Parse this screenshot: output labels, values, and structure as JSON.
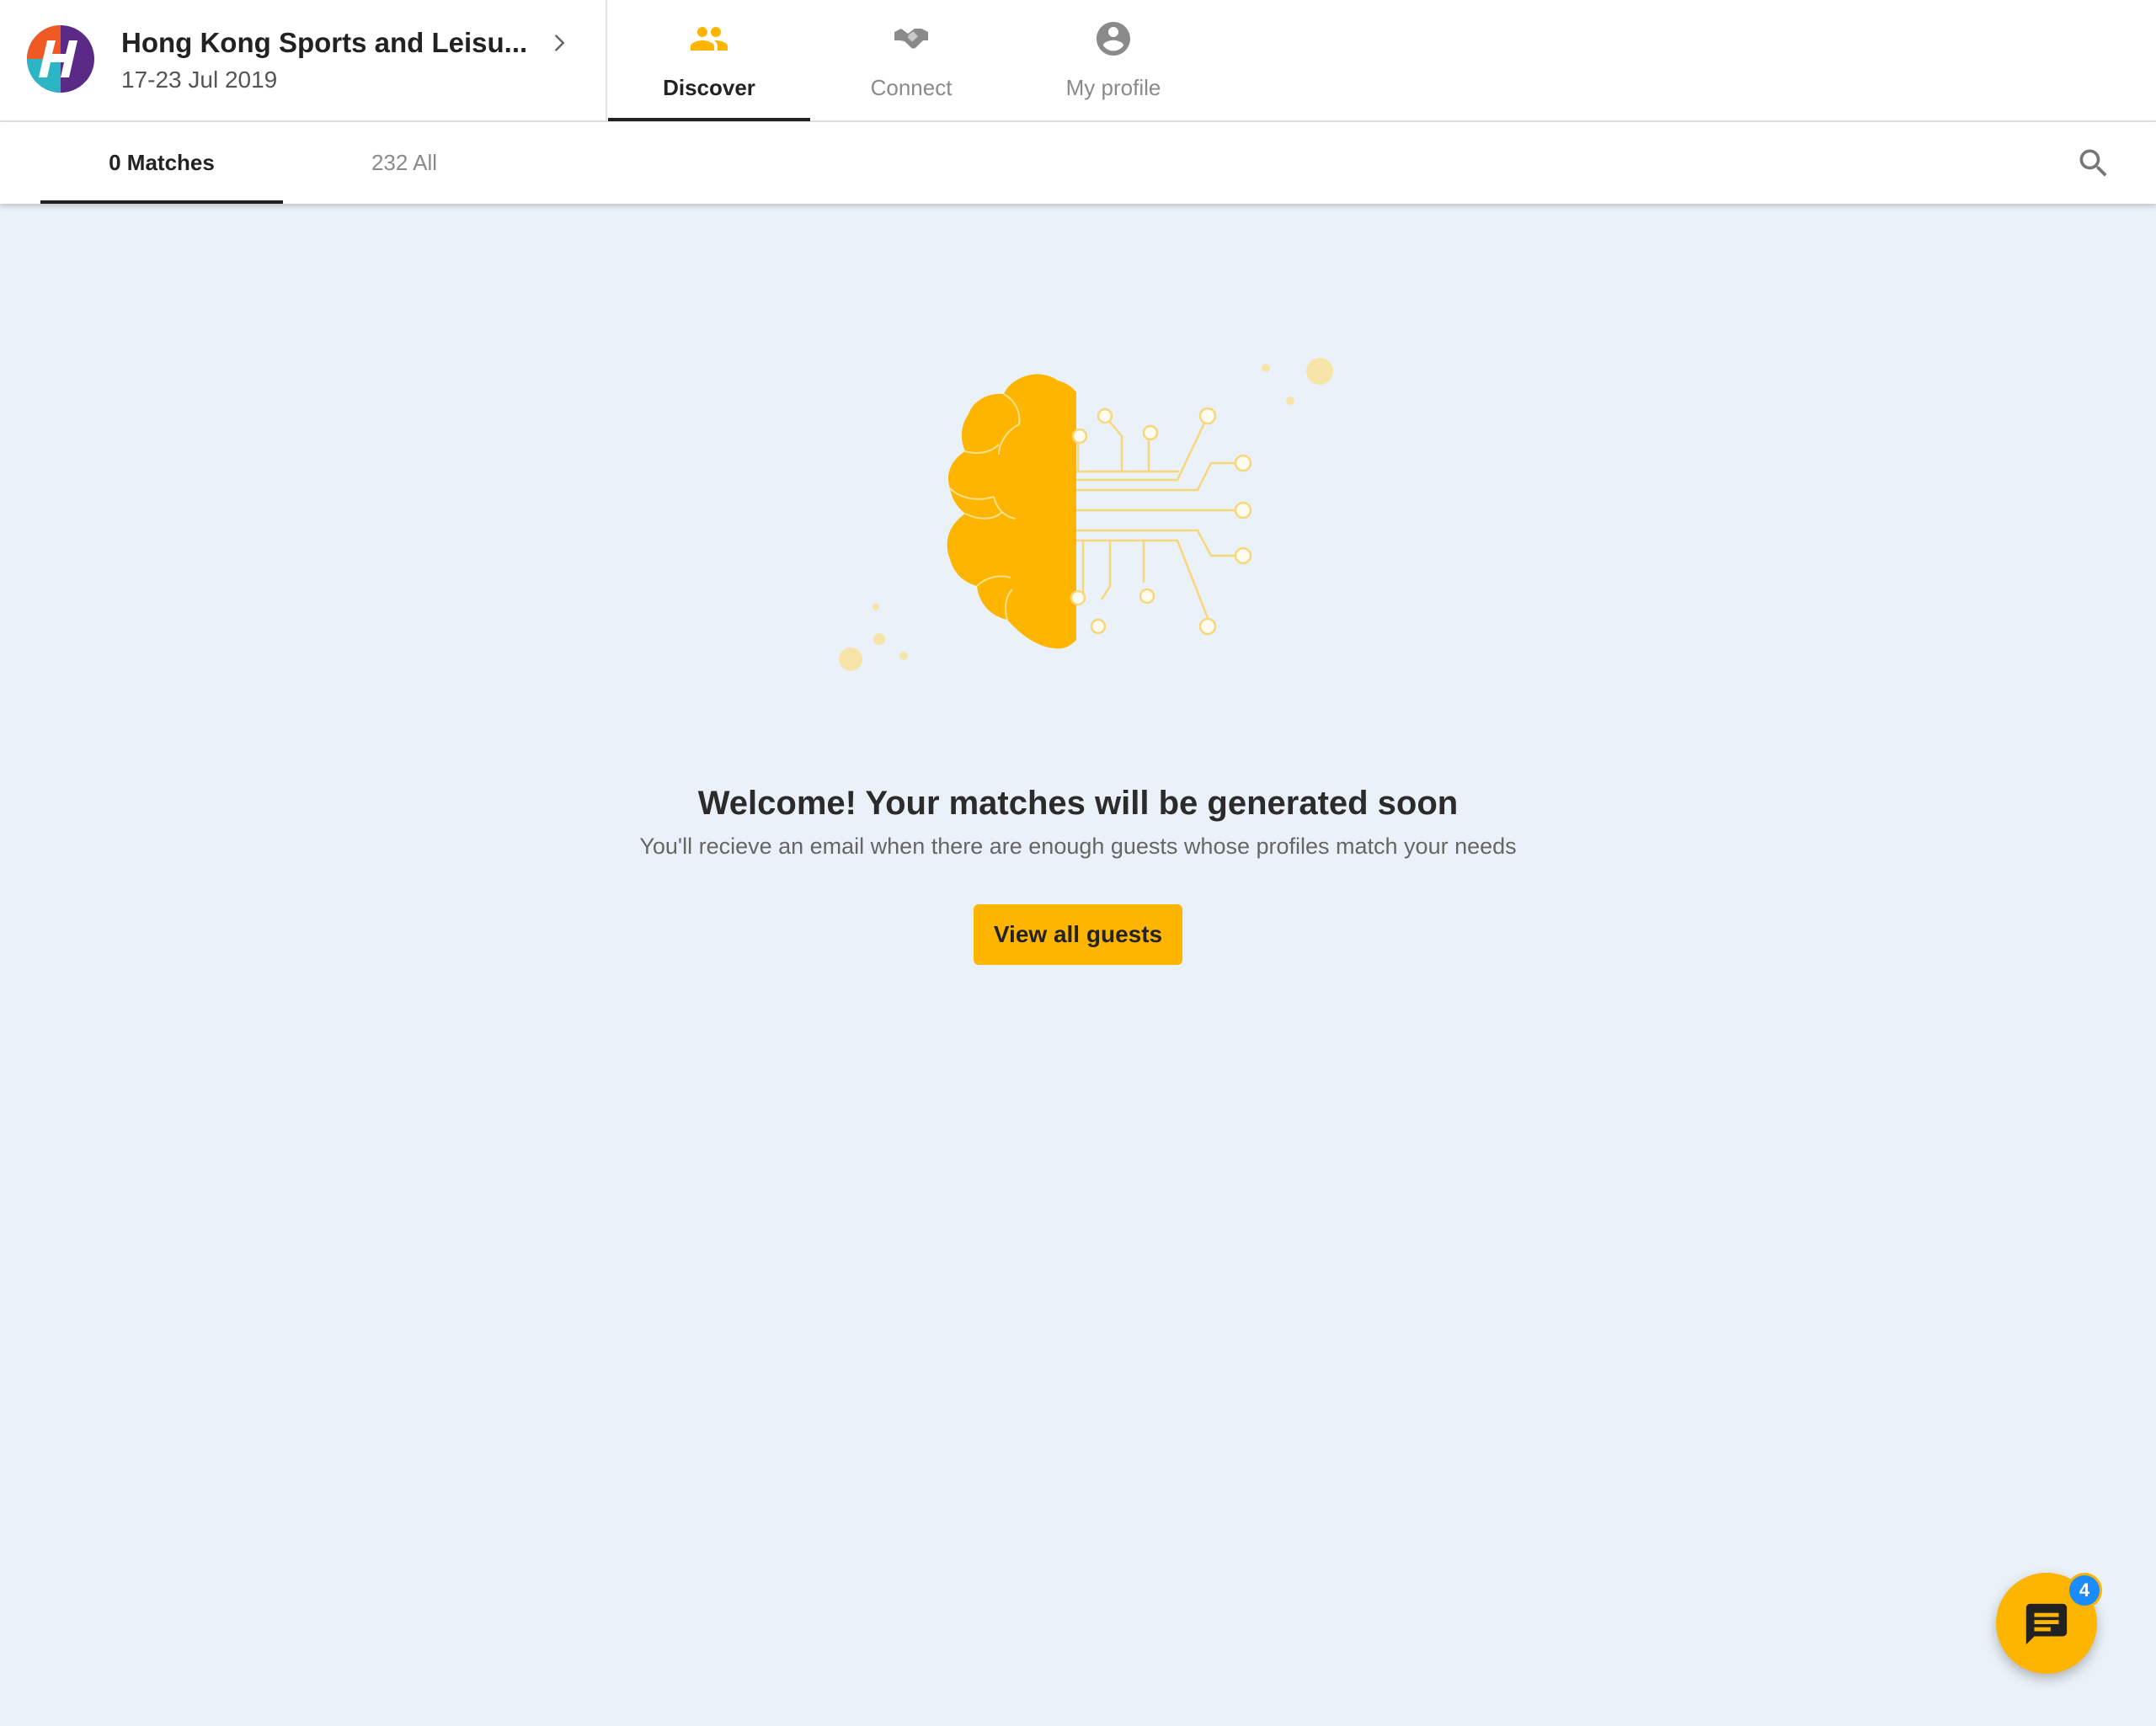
{
  "header": {
    "event_name": "Hong Kong Sports and Leisu...",
    "event_dates": "17-23 Jul 2019",
    "nav": [
      {
        "label": "Discover",
        "icon": "people-icon",
        "active": true
      },
      {
        "label": "Connect",
        "icon": "handshake-icon",
        "active": false
      },
      {
        "label": "My profile",
        "icon": "account-circle-icon",
        "active": false
      }
    ]
  },
  "subtabs": [
    {
      "label": "0 Matches",
      "active": true
    },
    {
      "label": "232 All",
      "active": false
    }
  ],
  "empty_state": {
    "title": "Welcome! Your matches will be generated soon",
    "subtitle": "You'll recieve an email when there are enough  guests whose profiles match your needs",
    "button_label": "View all guests"
  },
  "chat": {
    "badge_count": "4"
  },
  "colors": {
    "accent": "#fdb500",
    "badge": "#1a8cff",
    "background": "#eaf1f8",
    "text_dark": "#222222",
    "text_muted": "#8a8a8a"
  }
}
